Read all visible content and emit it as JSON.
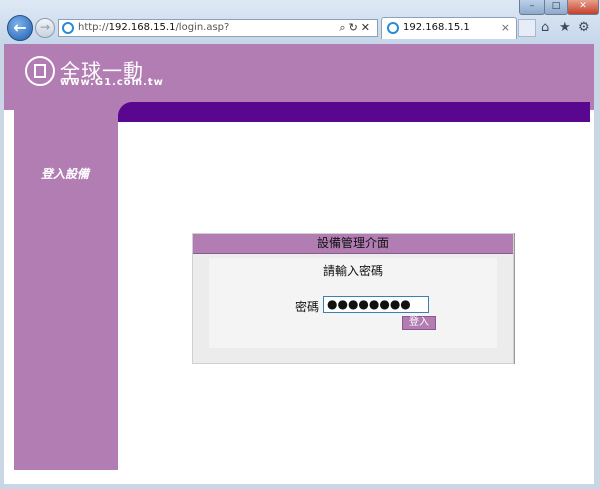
{
  "browser": {
    "url_prefix": "http://",
    "url_host": "192.168.15.1",
    "url_path": "/login.asp?",
    "tab_title": "192.168.15.1",
    "window_controls": {
      "min": "–",
      "max": "□",
      "close": "✕"
    },
    "icons": {
      "back": "←",
      "forward": "→",
      "search": "⌕",
      "refresh": "↻",
      "stop": "✕",
      "home": "⌂",
      "favorites": "★",
      "tools": "⚙",
      "tab_close": "×"
    }
  },
  "brand": {
    "name": "全球一動",
    "url": "www.G1.com.tw"
  },
  "sidebar": {
    "label": "登入設備"
  },
  "panel": {
    "title": "設備管理介面",
    "prompt": "請輸入密碼",
    "password_label": "密碼",
    "password_value": "●●●●●●●●",
    "login_label": "登入"
  },
  "colors": {
    "purple": "#b27db3",
    "dark_purple": "#5a078f"
  }
}
